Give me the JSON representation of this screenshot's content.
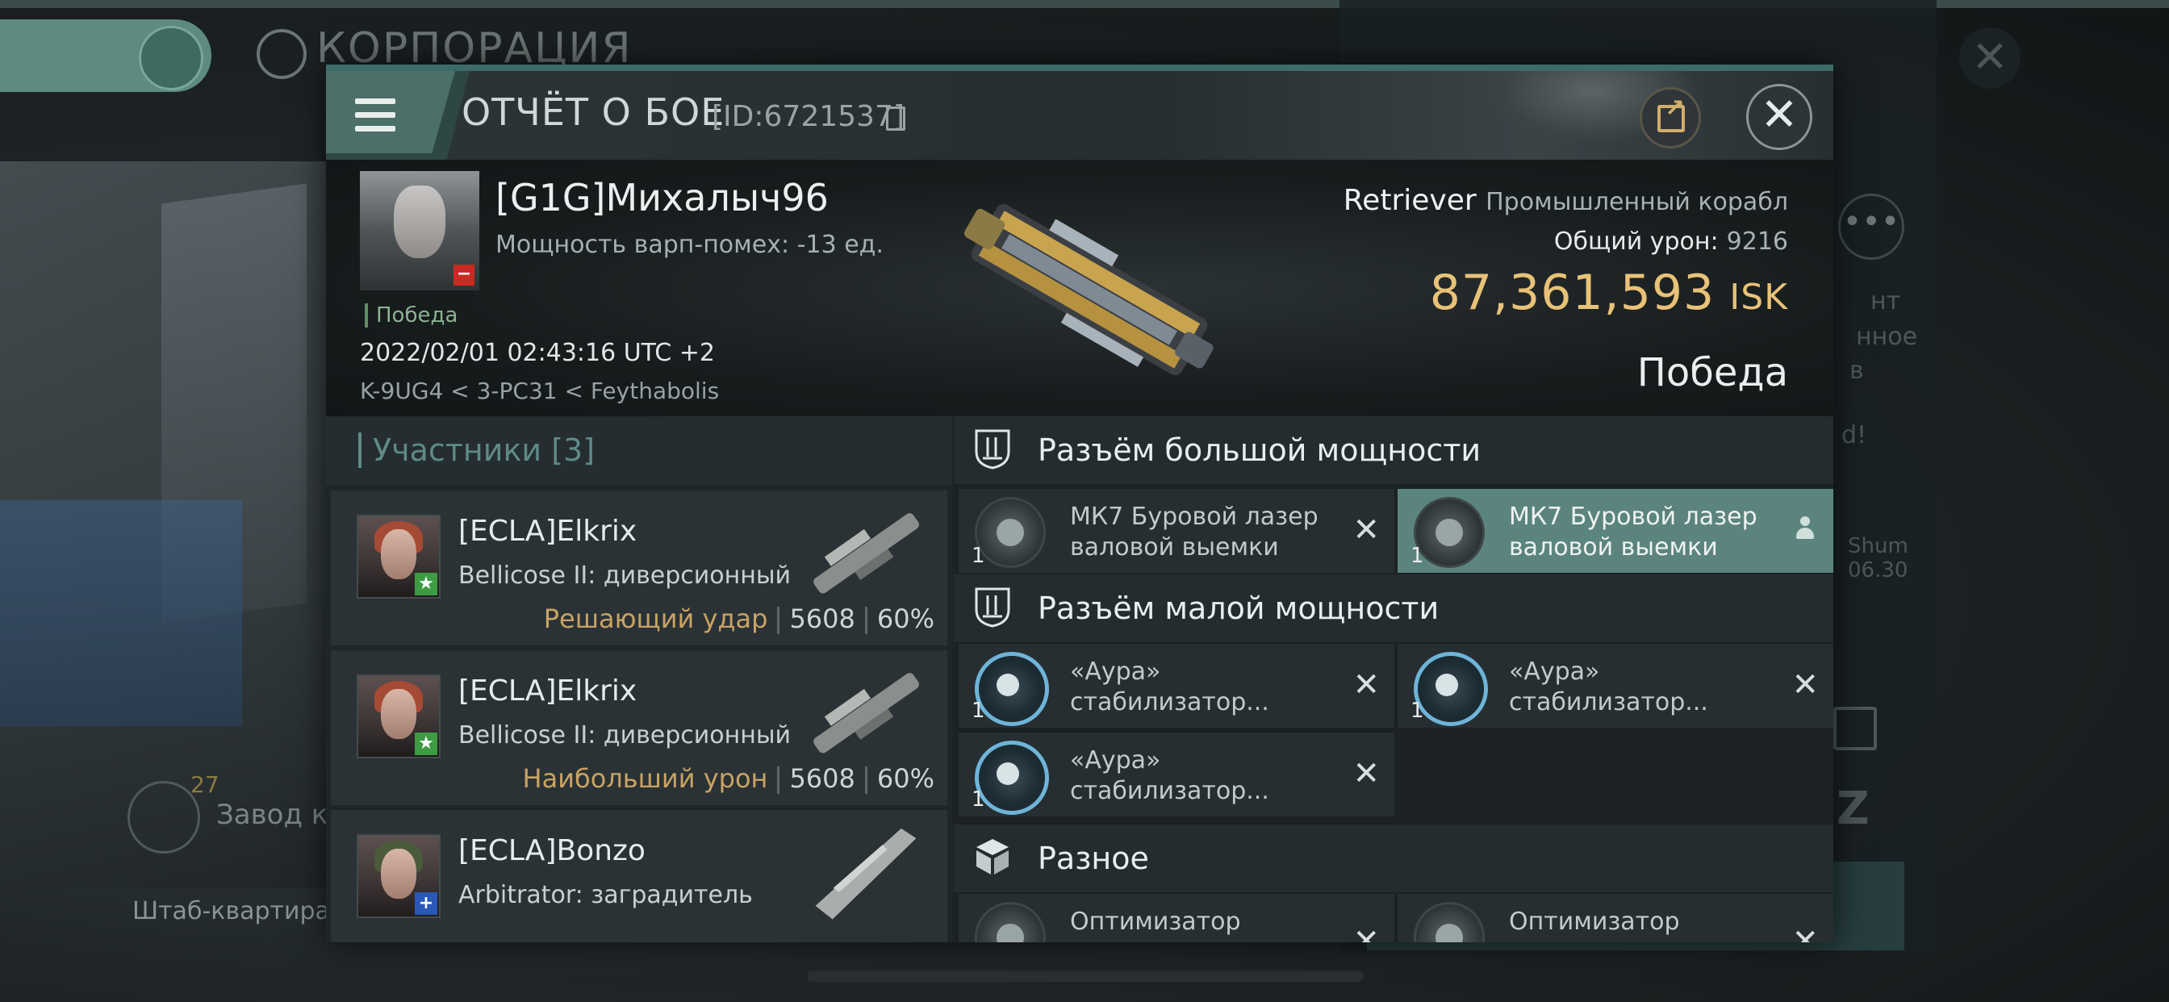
{
  "background": {
    "corp_title": "КОРПОРАЦИЯ",
    "factory_label": "Завод к",
    "factory_count": "27",
    "hq_label": "Штаб-квартира К",
    "side_text_1": "нт",
    "side_text_2": "нное",
    "side_text_3": "в",
    "side_text_4": "d!",
    "side_name": "Shum",
    "side_time": "06.30"
  },
  "modal": {
    "title": "ОТЧЁТ О БОЕ",
    "report_id": "[ID:6721537]",
    "close_glyph": "✕"
  },
  "victim": {
    "name": "[G1G]Михалыч96",
    "warp_disruption": "Мощность варп-помех: -13 ед.",
    "status_tag": "Победа",
    "datetime": "2022/02/01 02:43:16 UTC +2",
    "location": "K-9UG4 < 3-PC31 < Feythabolis",
    "ship_name": "Retriever",
    "ship_class": "Промышленный корабл",
    "total_damage_label": "Общий урон:",
    "total_damage": "9216",
    "isk_value": "87,361,593",
    "isk_unit": "ISK",
    "result": "Победа"
  },
  "participants": {
    "header": "Участники [3]",
    "rows": [
      {
        "name": "[ECLA]Elkrix",
        "ship": "Bellicose II: диверсионный",
        "tag": "Решающий удар",
        "damage": "5608",
        "percent": "60%"
      },
      {
        "name": "[ECLA]Elkrix",
        "ship": "Bellicose II: диверсионный",
        "tag": "Наибольший урон",
        "damage": "5608",
        "percent": "60%"
      },
      {
        "name": "[ECLA]Bonzo",
        "ship": "Arbitrator: заградитель",
        "tag": "",
        "damage": "",
        "percent": ""
      }
    ]
  },
  "fittings": {
    "high_slots": {
      "title": "Разъём большой мощности",
      "items": [
        {
          "line1": "МК7 Буровой лазер",
          "line2": "валовой выемки",
          "qty": "1"
        },
        {
          "line1": "МК7 Буровой лазер",
          "line2": "валовой выемки",
          "qty": "1"
        }
      ]
    },
    "low_slots": {
      "title": "Разъём малой мощности",
      "items": [
        {
          "line1": "«Аура»",
          "line2": "стабилизатор...",
          "qty": "1"
        },
        {
          "line1": "«Аура»",
          "line2": "стабилизатор...",
          "qty": "1"
        },
        {
          "line1": "«Аура»",
          "line2": "стабилизатор...",
          "qty": "1"
        }
      ]
    },
    "misc": {
      "title": "Разное",
      "items": [
        {
          "line1": "Оптимизатор",
          "qty": ""
        },
        {
          "line1": "Оптимизатор",
          "qty": ""
        }
      ]
    }
  }
}
